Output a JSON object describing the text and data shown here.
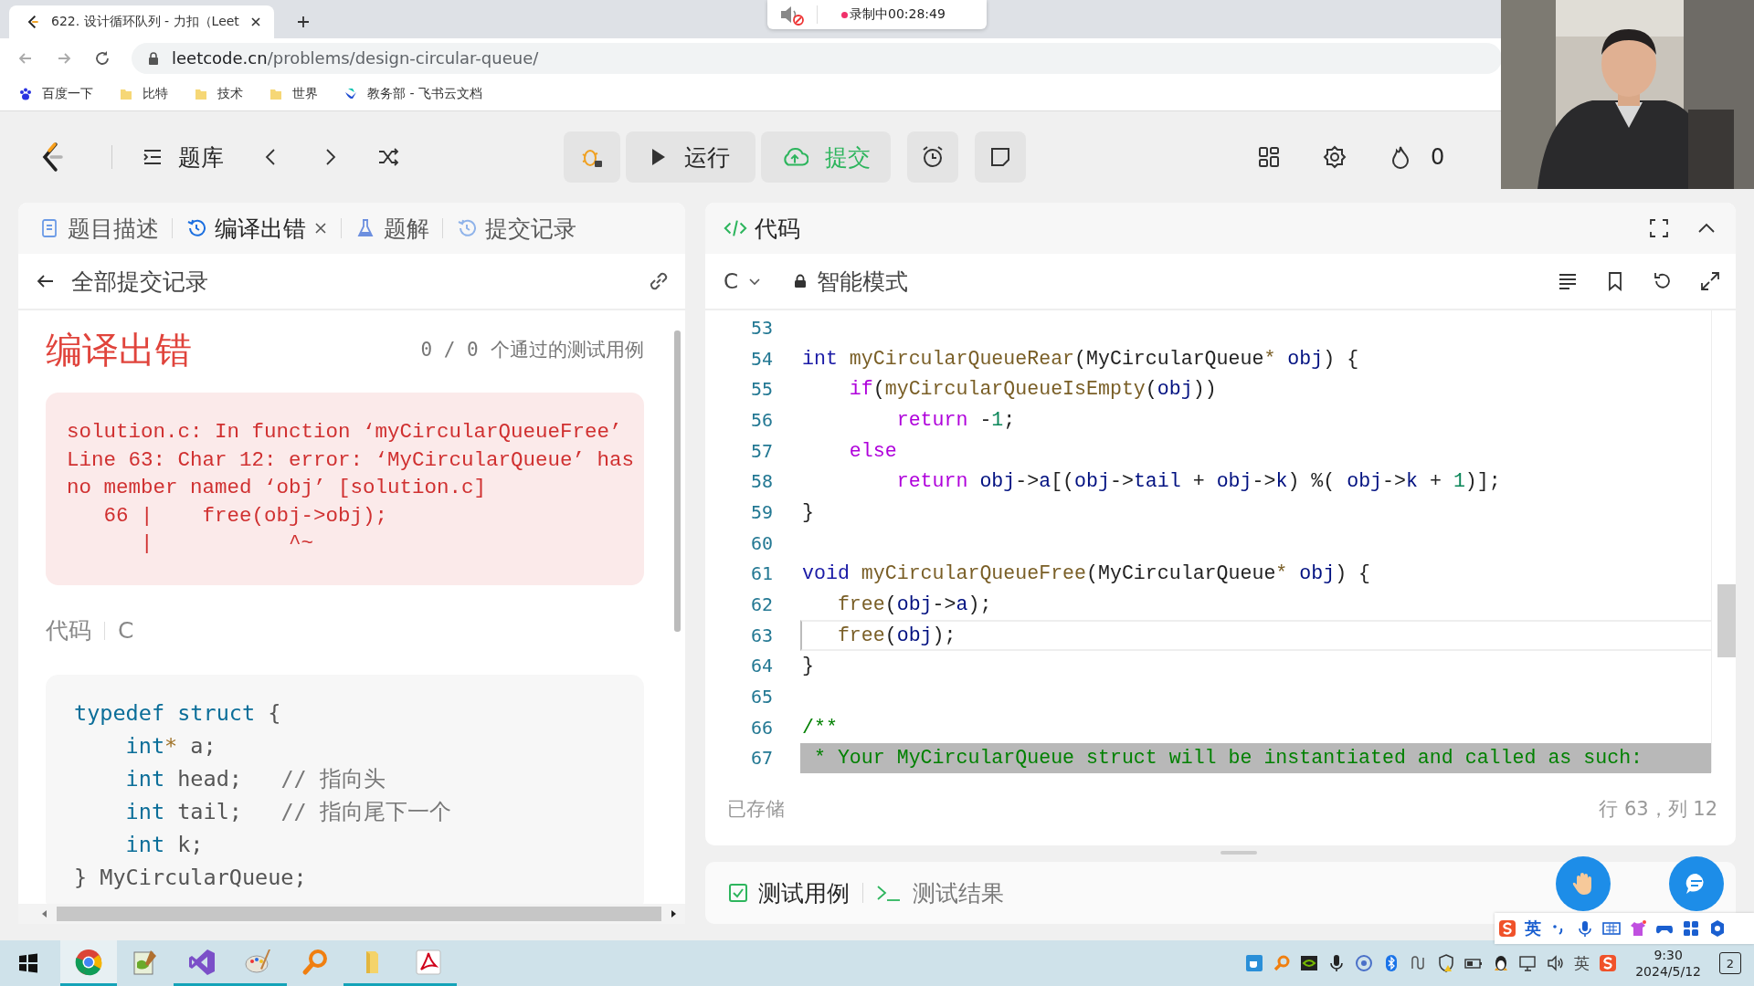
{
  "browser": {
    "tab_title": "622. 设计循环队列 - 力扣（Leet",
    "url_host": "leetcode.cn",
    "url_path": "/problems/design-circular-queue/",
    "bookmarks": [
      {
        "label": "百度一下",
        "kind": "paw"
      },
      {
        "label": "比特",
        "kind": "folder"
      },
      {
        "label": "技术",
        "kind": "folder"
      },
      {
        "label": "世界",
        "kind": "folder"
      },
      {
        "label": "教务部 - 飞书云文档",
        "kind": "feishu"
      }
    ]
  },
  "recording": {
    "label": "录制中00:28:49",
    "muted": true
  },
  "nav": {
    "problem_bank": "题库",
    "run": "运行",
    "submit": "提交",
    "streak": "0"
  },
  "left_panel": {
    "tabs": [
      {
        "label": "题目描述",
        "kind": "doc",
        "selected": false,
        "closable": false
      },
      {
        "label": "编译出错",
        "kind": "history",
        "selected": true,
        "closable": true
      },
      {
        "label": "题解",
        "kind": "flask",
        "selected": false,
        "closable": false
      },
      {
        "label": "提交记录",
        "kind": "history",
        "selected": false,
        "closable": false
      }
    ],
    "back_link": "全部提交记录",
    "result_title": "编译出错",
    "passed": "0 / 0",
    "passed_label": "个通过的测试用例",
    "error_lines": [
      "solution.c: In function ‘myCircularQueueFree’",
      "Line 63: Char 12: error: ‘MyCircularQueue’ has",
      "no member named ‘obj’ [solution.c]",
      "   66 |    free(obj->obj);",
      "      |           ^~"
    ],
    "code_label": "代码",
    "code_language": "C",
    "code": [
      [
        {
          "text": "typedef struct",
          "kind": "kw"
        },
        {
          "text": " {",
          "kind": "plain"
        }
      ],
      [
        {
          "text": "    int",
          "kind": "kw"
        },
        {
          "text": "*",
          "kind": "op"
        },
        {
          "text": " a;",
          "kind": "plain"
        }
      ],
      [
        {
          "text": "    int",
          "kind": "kw"
        },
        {
          "text": " head;   ",
          "kind": "plain"
        },
        {
          "text": "// 指向头",
          "kind": "com"
        }
      ],
      [
        {
          "text": "    int",
          "kind": "kw"
        },
        {
          "text": " tail;   ",
          "kind": "plain"
        },
        {
          "text": "// 指向尾下一个",
          "kind": "com"
        }
      ],
      [
        {
          "text": "    int",
          "kind": "kw"
        },
        {
          "text": " k;",
          "kind": "plain"
        }
      ],
      [
        {
          "text": "} MyCircularQueue;",
          "kind": "plain"
        }
      ]
    ]
  },
  "editor": {
    "title": "代码",
    "language": "C",
    "mode": "智能模式",
    "status": "已存储",
    "cursor": "行 63，列 12",
    "lines": [
      {
        "number": "53",
        "current": false,
        "selected": false
      },
      {
        "number": "54",
        "current": false,
        "selected": false,
        "tokens": [
          {
            "text": "int ",
            "kind": "kw"
          },
          {
            "text": "myCircularQueueRear",
            "kind": "fn"
          },
          {
            "text": "(MyCircularQueue",
            "kind": "plain"
          },
          {
            "text": "*",
            "kind": "op"
          },
          {
            "text": " obj",
            "kind": "var"
          },
          {
            "text": ") {",
            "kind": "plain"
          }
        ]
      },
      {
        "number": "55",
        "current": false,
        "selected": false,
        "tokens": [
          {
            "text": "    if",
            "kind": "ctrl"
          },
          {
            "text": "(",
            "kind": "plain"
          },
          {
            "text": "myCircularQueueIsEmpty",
            "kind": "fn"
          },
          {
            "text": "(",
            "kind": "plain"
          },
          {
            "text": "obj",
            "kind": "var"
          },
          {
            "text": "))",
            "kind": "plain"
          }
        ]
      },
      {
        "number": "56",
        "current": false,
        "selected": false,
        "tokens": [
          {
            "text": "        return",
            "kind": "ctrl"
          },
          {
            "text": " -",
            "kind": "plain"
          },
          {
            "text": "1",
            "kind": "num"
          },
          {
            "text": ";",
            "kind": "plain"
          }
        ]
      },
      {
        "number": "57",
        "current": false,
        "selected": false,
        "tokens": [
          {
            "text": "    else",
            "kind": "ctrl"
          }
        ]
      },
      {
        "number": "58",
        "current": false,
        "selected": false,
        "tokens": [
          {
            "text": "        return",
            "kind": "ctrl"
          },
          {
            "text": " obj",
            "kind": "var"
          },
          {
            "text": "->",
            "kind": "plain"
          },
          {
            "text": "a",
            "kind": "var"
          },
          {
            "text": "[(",
            "kind": "plain"
          },
          {
            "text": "obj",
            "kind": "var"
          },
          {
            "text": "->",
            "kind": "plain"
          },
          {
            "text": "tail",
            "kind": "var"
          },
          {
            "text": " + ",
            "kind": "plain"
          },
          {
            "text": "obj",
            "kind": "var"
          },
          {
            "text": "->",
            "kind": "plain"
          },
          {
            "text": "k",
            "kind": "var"
          },
          {
            "text": ") %( ",
            "kind": "plain"
          },
          {
            "text": "obj",
            "kind": "var"
          },
          {
            "text": "->",
            "kind": "plain"
          },
          {
            "text": "k",
            "kind": "var"
          },
          {
            "text": " + ",
            "kind": "plain"
          },
          {
            "text": "1",
            "kind": "num"
          },
          {
            "text": ")];",
            "kind": "plain"
          }
        ]
      },
      {
        "number": "59",
        "current": false,
        "selected": false,
        "tokens": [
          {
            "text": "}",
            "kind": "plain"
          }
        ]
      },
      {
        "number": "60",
        "current": false,
        "selected": false
      },
      {
        "number": "61",
        "current": false,
        "selected": false,
        "tokens": [
          {
            "text": "void ",
            "kind": "kw"
          },
          {
            "text": "myCircularQueueFree",
            "kind": "fn"
          },
          {
            "text": "(MyCircularQueue",
            "kind": "plain"
          },
          {
            "text": "*",
            "kind": "op"
          },
          {
            "text": " obj",
            "kind": "var"
          },
          {
            "text": ") {",
            "kind": "plain"
          }
        ]
      },
      {
        "number": "62",
        "current": false,
        "selected": false,
        "tokens": [
          {
            "text": "   free",
            "kind": "fn"
          },
          {
            "text": "(",
            "kind": "plain"
          },
          {
            "text": "obj",
            "kind": "var"
          },
          {
            "text": "->",
            "kind": "plain"
          },
          {
            "text": "a",
            "kind": "var"
          },
          {
            "text": ");",
            "kind": "plain"
          }
        ]
      },
      {
        "number": "63",
        "current": true,
        "selected": false,
        "tokens": [
          {
            "text": "   free",
            "kind": "fn"
          },
          {
            "text": "(",
            "kind": "plain"
          },
          {
            "text": "obj",
            "kind": "var"
          },
          {
            "text": ");",
            "kind": "plain"
          }
        ]
      },
      {
        "number": "64",
        "current": false,
        "selected": false,
        "tokens": [
          {
            "text": "}",
            "kind": "plain"
          }
        ]
      },
      {
        "number": "65",
        "current": false,
        "selected": false
      },
      {
        "number": "66",
        "current": false,
        "selected": false,
        "tokens": [
          {
            "text": "/**",
            "kind": "com"
          }
        ]
      },
      {
        "number": "67",
        "current": false,
        "selected": true,
        "tokens": [
          {
            "text": " * Your MyCircularQueue struct will be instantiated and called as such:",
            "kind": "com"
          }
        ]
      }
    ]
  },
  "bottom_panel": {
    "tabs": [
      {
        "label": "测试用例",
        "kind": "check",
        "selected": true
      },
      {
        "label": "测试结果",
        "kind": "terminal",
        "selected": false
      }
    ]
  },
  "ime_bar": {
    "label": "英"
  },
  "taskbar": {
    "apps": [
      {
        "kind": "chrome",
        "running": true,
        "selected": true
      },
      {
        "kind": "notepad",
        "running": false,
        "selected": false
      },
      {
        "kind": "vs",
        "running": true,
        "selected": false
      },
      {
        "kind": "paint",
        "running": true,
        "selected": false
      },
      {
        "kind": "magnifier",
        "running": false,
        "selected": false
      },
      {
        "kind": "folder",
        "running": true,
        "selected": false
      },
      {
        "kind": "pdf",
        "running": true,
        "selected": false
      }
    ],
    "tray": [
      {
        "kind": "cup"
      },
      {
        "kind": "magnifier"
      },
      {
        "kind": "nvidia"
      },
      {
        "kind": "mic"
      },
      {
        "kind": "disc"
      },
      {
        "kind": "bluetooth"
      },
      {
        "kind": "wave"
      },
      {
        "kind": "shield"
      },
      {
        "kind": "battery"
      },
      {
        "kind": "penguin"
      },
      {
        "kind": "network"
      },
      {
        "kind": "volume"
      }
    ],
    "ime": "英",
    "time": "9:30",
    "date": "2024/5/12",
    "notifications": "2"
  }
}
